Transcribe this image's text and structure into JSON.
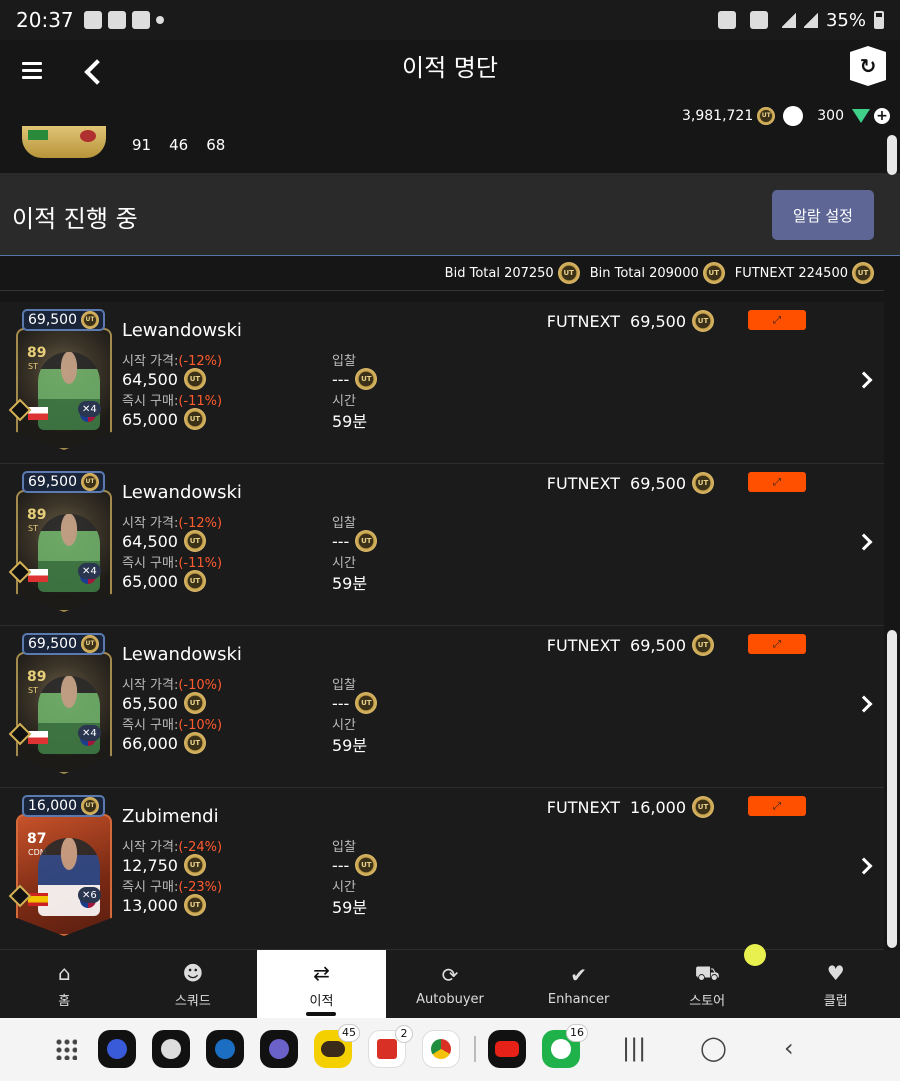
{
  "status_bar": {
    "time": "20:37",
    "battery": "35%"
  },
  "header": {
    "title": "이적 명단"
  },
  "currency": {
    "coins": "3,981,721",
    "points": "300"
  },
  "top_card": {
    "stats": [
      "91",
      "46",
      "68"
    ]
  },
  "section": {
    "title": "이적 진행 중",
    "alert_button": "알람 설정"
  },
  "totals": {
    "bid": "Bid Total 207250",
    "bin": "Bin Total 209000",
    "futnext": "FUTNEXT 224500"
  },
  "labels": {
    "start_price": "시작 가격:",
    "buy_now": "즉시 구매:",
    "bid": "입찰",
    "time": "시간",
    "futnext": "FUTNEXT",
    "coin": "UT"
  },
  "listings": [
    {
      "badge_price": "69,500",
      "name": "Lewandowski",
      "ovr": "89",
      "pos": "ST",
      "chem": "4",
      "start_pct": "(-12%)",
      "start_price": "64,500",
      "bin_pct": "(-11%)",
      "bin_price": "65,000",
      "bid": "---",
      "time": "59분",
      "futnext_price": "69,500",
      "card_type": "black"
    },
    {
      "badge_price": "69,500",
      "name": "Lewandowski",
      "ovr": "89",
      "pos": "ST",
      "chem": "4",
      "start_pct": "(-12%)",
      "start_price": "64,500",
      "bin_pct": "(-11%)",
      "bin_price": "65,000",
      "bid": "---",
      "time": "59분",
      "futnext_price": "69,500",
      "card_type": "black"
    },
    {
      "badge_price": "69,500",
      "name": "Lewandowski",
      "ovr": "89",
      "pos": "ST",
      "chem": "4",
      "start_pct": "(-10%)",
      "start_price": "65,500",
      "bin_pct": "(-10%)",
      "bin_price": "66,000",
      "bid": "---",
      "time": "59분",
      "futnext_price": "69,500",
      "card_type": "black"
    },
    {
      "badge_price": "16,000",
      "name": "Zubimendi",
      "ovr": "87",
      "pos": "CDM",
      "chem": "6",
      "start_pct": "(-24%)",
      "start_price": "12,750",
      "bin_pct": "(-23%)",
      "bin_price": "13,000",
      "bid": "---",
      "time": "59분",
      "futnext_price": "16,000",
      "card_type": "orange"
    }
  ],
  "nav": [
    {
      "label": "홈",
      "icon": "home-icon"
    },
    {
      "label": "스쿼드",
      "icon": "squad-icon"
    },
    {
      "label": "이적",
      "icon": "transfer-icon",
      "active": true
    },
    {
      "label": "Autobuyer",
      "icon": "autobuyer-icon"
    },
    {
      "label": "Enhancer",
      "icon": "check-icon"
    },
    {
      "label": "스토어",
      "icon": "cart-icon"
    },
    {
      "label": "클럽",
      "icon": "club-icon"
    }
  ],
  "dock": {
    "talk_badge": "45",
    "gmail_badge": "2",
    "line_badge": "16"
  }
}
